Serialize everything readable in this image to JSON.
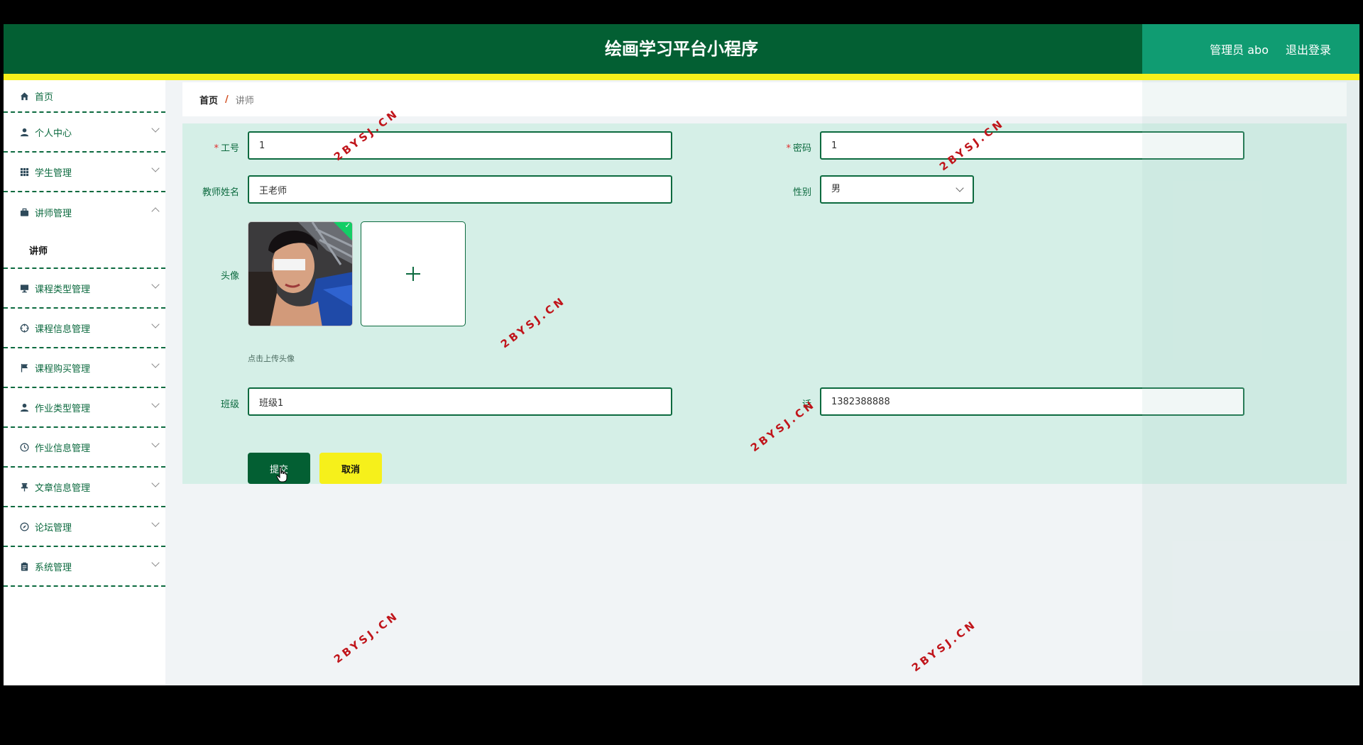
{
  "header": {
    "title": "绘画学习平台小程序",
    "user_label": "管理员 abo",
    "logout_label": "退出登录"
  },
  "sidebar": {
    "items": [
      {
        "label": "首页",
        "icon": "home-icon"
      },
      {
        "label": "个人中心",
        "icon": "user-icon"
      },
      {
        "label": "学生管理",
        "icon": "grid-icon"
      },
      {
        "label": "讲师管理",
        "icon": "briefcase-icon"
      },
      {
        "label": "课程类型管理",
        "icon": "monitor-icon"
      },
      {
        "label": "课程信息管理",
        "icon": "crosshair-icon"
      },
      {
        "label": "课程购买管理",
        "icon": "flag-icon"
      },
      {
        "label": "作业类型管理",
        "icon": "user-icon"
      },
      {
        "label": "作业信息管理",
        "icon": "clock-icon"
      },
      {
        "label": "文章信息管理",
        "icon": "pushpin-icon"
      },
      {
        "label": "论坛管理",
        "icon": "compass-icon"
      },
      {
        "label": "系统管理",
        "icon": "clipboard-icon"
      }
    ],
    "submenu_active": "讲师"
  },
  "breadcrumb": {
    "home": "首页",
    "separator": "/",
    "current": "讲师"
  },
  "form": {
    "job_no_label": "工号",
    "job_no_value": "1",
    "password_label": "密码",
    "password_value": "1",
    "teacher_name_label": "教师姓名",
    "teacher_name_value": "王老师",
    "gender_label": "性别",
    "gender_value": "男",
    "avatar_label": "头像",
    "avatar_tip": "点击上传头像",
    "class_label": "班级",
    "class_value": "班级1",
    "phone_label": "话",
    "phone_value": "1382388888",
    "submit_label": "提交",
    "cancel_label": "取消"
  },
  "watermark": "2BYSJ.CN",
  "colors": {
    "primary_green": "#035f33",
    "header_right": "#109c72",
    "accent_yellow": "#f6f01b",
    "form_bg": "#d5efe7",
    "required_star": "#e02d2d",
    "watermark": "#c0141a"
  }
}
